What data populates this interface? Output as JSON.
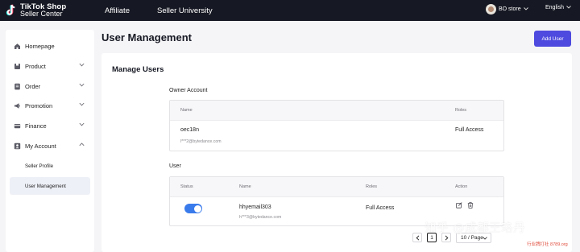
{
  "topbar": {
    "logo_line1": "TikTok Shop",
    "logo_line2": "Seller Center",
    "nav": [
      "Affiliate",
      "Seller University"
    ],
    "store_name": "BO store",
    "language": "English"
  },
  "sidebar": {
    "items": [
      {
        "label": "Homepage",
        "icon": "home-icon"
      },
      {
        "label": "Product",
        "icon": "product-icon"
      },
      {
        "label": "Order",
        "icon": "order-icon"
      },
      {
        "label": "Promotion",
        "icon": "megaphone-icon"
      },
      {
        "label": "Finance",
        "icon": "card-icon"
      },
      {
        "label": "My Account",
        "icon": "user-icon"
      }
    ],
    "sub_items": [
      {
        "label": "Seller Profile"
      },
      {
        "label": "User Management"
      }
    ]
  },
  "page": {
    "title": "User Management",
    "add_user_label": "Add User"
  },
  "card": {
    "title": "Manage Users",
    "owner_section": {
      "label": "Owner Account",
      "columns": [
        "Name",
        "Roles"
      ],
      "row": {
        "name": "oec18n",
        "email": "l***2@bytedance.com",
        "role": "Full Access"
      }
    },
    "user_section": {
      "label": "User",
      "columns": [
        "Status",
        "Name",
        "Roles",
        "Action"
      ],
      "rows": [
        {
          "status_on": true,
          "name": "hhyemail303",
          "email": "h***3@bytedance.com",
          "role": "Full Access"
        }
      ]
    },
    "pagination": {
      "current_page": "1",
      "page_size": "10 / Page"
    }
  },
  "watermark": {
    "main": "知乎 @成都王珞丹",
    "sub": "行业牌打社 8789.org"
  },
  "colors": {
    "topbar_bg": "#161823",
    "accent": "#4e4adf",
    "toggle_on": "#3a7bec",
    "page_bg": "#f5f5f7"
  }
}
